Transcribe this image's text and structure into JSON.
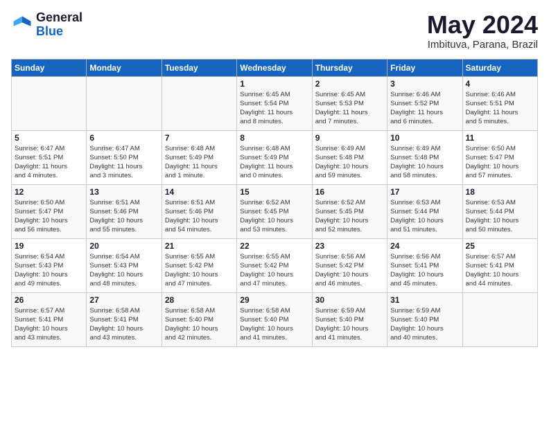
{
  "header": {
    "logo_general": "General",
    "logo_blue": "Blue",
    "month_year": "May 2024",
    "location": "Imbituva, Parana, Brazil"
  },
  "days_of_week": [
    "Sunday",
    "Monday",
    "Tuesday",
    "Wednesday",
    "Thursday",
    "Friday",
    "Saturday"
  ],
  "weeks": [
    [
      {
        "day": "",
        "info": ""
      },
      {
        "day": "",
        "info": ""
      },
      {
        "day": "",
        "info": ""
      },
      {
        "day": "1",
        "info": "Sunrise: 6:45 AM\nSunset: 5:54 PM\nDaylight: 11 hours\nand 8 minutes."
      },
      {
        "day": "2",
        "info": "Sunrise: 6:45 AM\nSunset: 5:53 PM\nDaylight: 11 hours\nand 7 minutes."
      },
      {
        "day": "3",
        "info": "Sunrise: 6:46 AM\nSunset: 5:52 PM\nDaylight: 11 hours\nand 6 minutes."
      },
      {
        "day": "4",
        "info": "Sunrise: 6:46 AM\nSunset: 5:51 PM\nDaylight: 11 hours\nand 5 minutes."
      }
    ],
    [
      {
        "day": "5",
        "info": "Sunrise: 6:47 AM\nSunset: 5:51 PM\nDaylight: 11 hours\nand 4 minutes."
      },
      {
        "day": "6",
        "info": "Sunrise: 6:47 AM\nSunset: 5:50 PM\nDaylight: 11 hours\nand 3 minutes."
      },
      {
        "day": "7",
        "info": "Sunrise: 6:48 AM\nSunset: 5:49 PM\nDaylight: 11 hours\nand 1 minute."
      },
      {
        "day": "8",
        "info": "Sunrise: 6:48 AM\nSunset: 5:49 PM\nDaylight: 11 hours\nand 0 minutes."
      },
      {
        "day": "9",
        "info": "Sunrise: 6:49 AM\nSunset: 5:48 PM\nDaylight: 10 hours\nand 59 minutes."
      },
      {
        "day": "10",
        "info": "Sunrise: 6:49 AM\nSunset: 5:48 PM\nDaylight: 10 hours\nand 58 minutes."
      },
      {
        "day": "11",
        "info": "Sunrise: 6:50 AM\nSunset: 5:47 PM\nDaylight: 10 hours\nand 57 minutes."
      }
    ],
    [
      {
        "day": "12",
        "info": "Sunrise: 6:50 AM\nSunset: 5:47 PM\nDaylight: 10 hours\nand 56 minutes."
      },
      {
        "day": "13",
        "info": "Sunrise: 6:51 AM\nSunset: 5:46 PM\nDaylight: 10 hours\nand 55 minutes."
      },
      {
        "day": "14",
        "info": "Sunrise: 6:51 AM\nSunset: 5:46 PM\nDaylight: 10 hours\nand 54 minutes."
      },
      {
        "day": "15",
        "info": "Sunrise: 6:52 AM\nSunset: 5:45 PM\nDaylight: 10 hours\nand 53 minutes."
      },
      {
        "day": "16",
        "info": "Sunrise: 6:52 AM\nSunset: 5:45 PM\nDaylight: 10 hours\nand 52 minutes."
      },
      {
        "day": "17",
        "info": "Sunrise: 6:53 AM\nSunset: 5:44 PM\nDaylight: 10 hours\nand 51 minutes."
      },
      {
        "day": "18",
        "info": "Sunrise: 6:53 AM\nSunset: 5:44 PM\nDaylight: 10 hours\nand 50 minutes."
      }
    ],
    [
      {
        "day": "19",
        "info": "Sunrise: 6:54 AM\nSunset: 5:43 PM\nDaylight: 10 hours\nand 49 minutes."
      },
      {
        "day": "20",
        "info": "Sunrise: 6:54 AM\nSunset: 5:43 PM\nDaylight: 10 hours\nand 48 minutes."
      },
      {
        "day": "21",
        "info": "Sunrise: 6:55 AM\nSunset: 5:42 PM\nDaylight: 10 hours\nand 47 minutes."
      },
      {
        "day": "22",
        "info": "Sunrise: 6:55 AM\nSunset: 5:42 PM\nDaylight: 10 hours\nand 47 minutes."
      },
      {
        "day": "23",
        "info": "Sunrise: 6:56 AM\nSunset: 5:42 PM\nDaylight: 10 hours\nand 46 minutes."
      },
      {
        "day": "24",
        "info": "Sunrise: 6:56 AM\nSunset: 5:41 PM\nDaylight: 10 hours\nand 45 minutes."
      },
      {
        "day": "25",
        "info": "Sunrise: 6:57 AM\nSunset: 5:41 PM\nDaylight: 10 hours\nand 44 minutes."
      }
    ],
    [
      {
        "day": "26",
        "info": "Sunrise: 6:57 AM\nSunset: 5:41 PM\nDaylight: 10 hours\nand 43 minutes."
      },
      {
        "day": "27",
        "info": "Sunrise: 6:58 AM\nSunset: 5:41 PM\nDaylight: 10 hours\nand 43 minutes."
      },
      {
        "day": "28",
        "info": "Sunrise: 6:58 AM\nSunset: 5:40 PM\nDaylight: 10 hours\nand 42 minutes."
      },
      {
        "day": "29",
        "info": "Sunrise: 6:58 AM\nSunset: 5:40 PM\nDaylight: 10 hours\nand 41 minutes."
      },
      {
        "day": "30",
        "info": "Sunrise: 6:59 AM\nSunset: 5:40 PM\nDaylight: 10 hours\nand 41 minutes."
      },
      {
        "day": "31",
        "info": "Sunrise: 6:59 AM\nSunset: 5:40 PM\nDaylight: 10 hours\nand 40 minutes."
      },
      {
        "day": "",
        "info": ""
      }
    ]
  ]
}
